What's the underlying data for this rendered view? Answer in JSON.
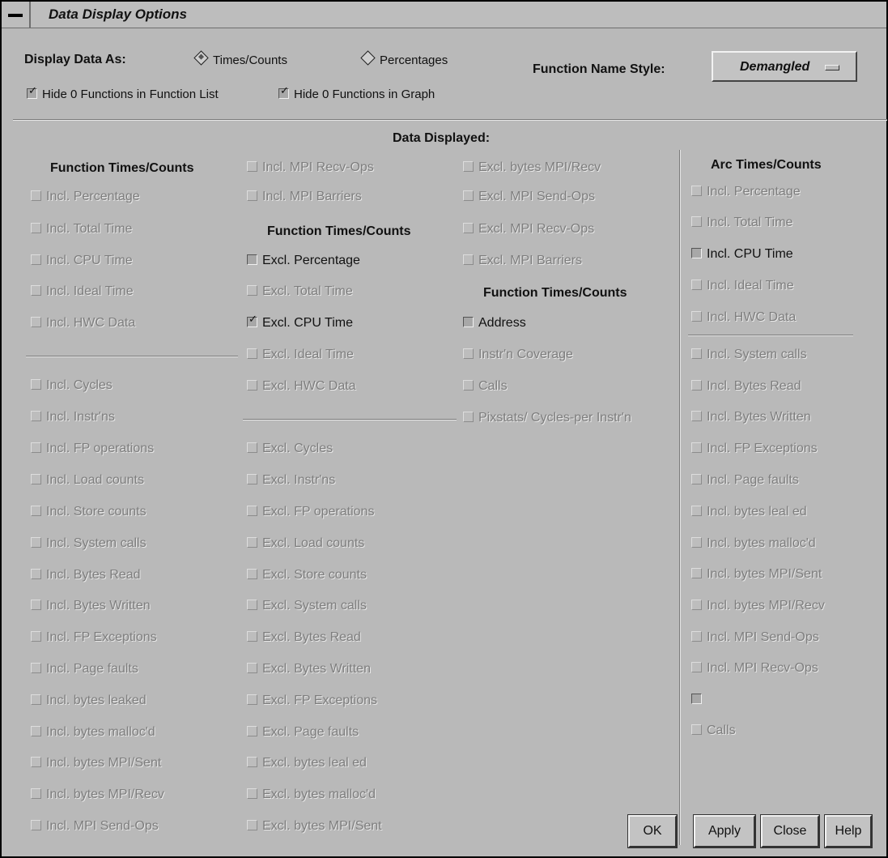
{
  "window": {
    "title": "Data Display Options"
  },
  "display": {
    "label": "Display Data As:",
    "times_counts": "Times/Counts",
    "percentages": "Percentages",
    "hide_list": "Hide 0 Functions in Function List",
    "hide_graph": "Hide 0 Functions in Graph",
    "name_style_label": "Function Name Style:",
    "name_style_value": "Demangled"
  },
  "data_displayed": "Data Displayed:",
  "headers": {
    "col1": "Function Times/Counts",
    "col2": "Function Times/Counts",
    "col3": "Function Times/Counts",
    "col4": "Arc Times/Counts"
  },
  "col1": [
    "Incl. Percentage",
    "Incl. Total Time",
    "Incl. CPU Time",
    "Incl. Ideal Time",
    "Incl. HWC Data",
    "Incl. Cycles",
    "Incl. Instr'ns",
    "Incl. FP operations",
    "Incl. Load counts",
    "Incl. Store counts",
    "Incl. System calls",
    "Incl. Bytes Read",
    "Incl. Bytes Written",
    "Incl. FP Exceptions",
    "Incl. Page faults",
    "Incl. bytes leaked",
    "Incl. bytes malloc'd",
    "Incl. bytes MPI/Sent",
    "Incl. bytes MPI/Recv",
    "Incl. MPI Send-Ops"
  ],
  "col2": [
    "Incl. MPI Recv-Ops",
    "Incl. MPI Barriers",
    "Excl. Percentage",
    "Excl. Total Time",
    "Excl. CPU Time",
    "Excl. Ideal Time",
    "Excl. HWC Data",
    "Excl. Cycles",
    "Excl. Instr'ns",
    "Excl. FP operations",
    "Excl. Load counts",
    "Excl. Store counts",
    "Excl. System calls",
    "Excl. Bytes Read",
    "Excl. Bytes Written",
    "Excl. FP Exceptions",
    "Excl. Page faults",
    "Excl. bytes leal ed",
    "Excl. bytes malloc'd",
    "Excl. bytes MPI/Sent"
  ],
  "col3": [
    "Excl. bytes MPI/Recv",
    "Excl. MPI Send-Ops",
    "Excl. MPI Recv-Ops",
    "Excl. MPI Barriers",
    "Address",
    "Instr'n Coverage",
    "Calls",
    "Pixstats/ Cycles-per Instr'n"
  ],
  "col4": [
    "Incl. Percentage",
    "Incl. Total Time",
    "Incl. CPU Time",
    "Incl. Ideal Time",
    "Incl. HWC Data",
    "Incl. System calls",
    "Incl. Bytes Read",
    "Incl. Bytes Written",
    "Incl. FP Exceptions",
    "Incl. Page faults",
    "Incl. bytes leal ed",
    "Incl. bytes malloc'd",
    "Incl. bytes MPI/Sent",
    "Incl. bytes MPI/Recv",
    "Incl. MPI Send-Ops",
    "Incl. MPI Recv-Ops",
    "",
    "Calls"
  ],
  "buttons": {
    "ok": "OK",
    "apply": "Apply",
    "close": "Close",
    "help": "Help"
  }
}
